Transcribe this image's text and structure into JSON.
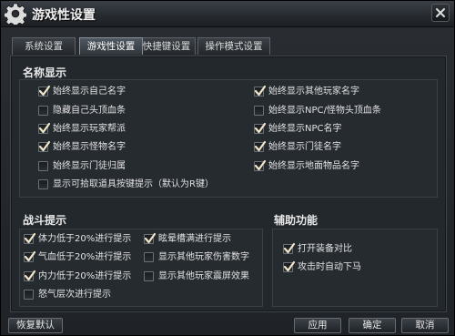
{
  "window": {
    "title": "游戏性设置"
  },
  "tabs": [
    {
      "label": "系统设置",
      "active": false
    },
    {
      "label": "游戏性设置",
      "active": true
    },
    {
      "label": "快捷键设置",
      "active": false
    },
    {
      "label": "操作模式设置",
      "active": false
    }
  ],
  "name_display": {
    "title": "名称显示",
    "options": [
      {
        "label": "始终显示自己名字",
        "checked": true
      },
      {
        "label": "隐藏自己头顶血条",
        "checked": false
      },
      {
        "label": "始终显示玩家帮派",
        "checked": true
      },
      {
        "label": "始终显示怪物名字",
        "checked": true
      },
      {
        "label": "始终显示门徒归属",
        "checked": false
      },
      {
        "label": "显示可拾取道具按键提示（默认为R键）",
        "checked": false
      },
      {
        "label": "始终显示其他玩家名字",
        "checked": true
      },
      {
        "label": "始终显示NPC/怪物头顶血条",
        "checked": false
      },
      {
        "label": "始终显示NPC名字",
        "checked": true
      },
      {
        "label": "始终显示门徒名字",
        "checked": true
      },
      {
        "label": "始终显示地面物品名字",
        "checked": true
      }
    ]
  },
  "combat_hints": {
    "title": "战斗提示",
    "options": [
      {
        "label": "体力低于20%进行提示",
        "checked": true
      },
      {
        "label": "气血低于20%进行提示",
        "checked": true
      },
      {
        "label": "内力低于20%进行提示",
        "checked": true
      },
      {
        "label": "怒气层次进行提示",
        "checked": false
      },
      {
        "label": "眩晕槽满进行提示",
        "checked": true
      },
      {
        "label": "显示其他玩家伤害数字",
        "checked": false
      },
      {
        "label": "显示其他玩家震屏效果",
        "checked": false
      }
    ]
  },
  "assist": {
    "title": "辅助功能",
    "options": [
      {
        "label": "打开装备对比",
        "checked": true
      },
      {
        "label": "攻击时自动下马",
        "checked": true
      }
    ]
  },
  "buttons": {
    "restore_default": "恢复默认",
    "apply": "应用",
    "confirm": "确定",
    "cancel": "取消"
  },
  "colors": {
    "checkmark": "#f0e6c8",
    "accent_border": "#8a9098"
  }
}
